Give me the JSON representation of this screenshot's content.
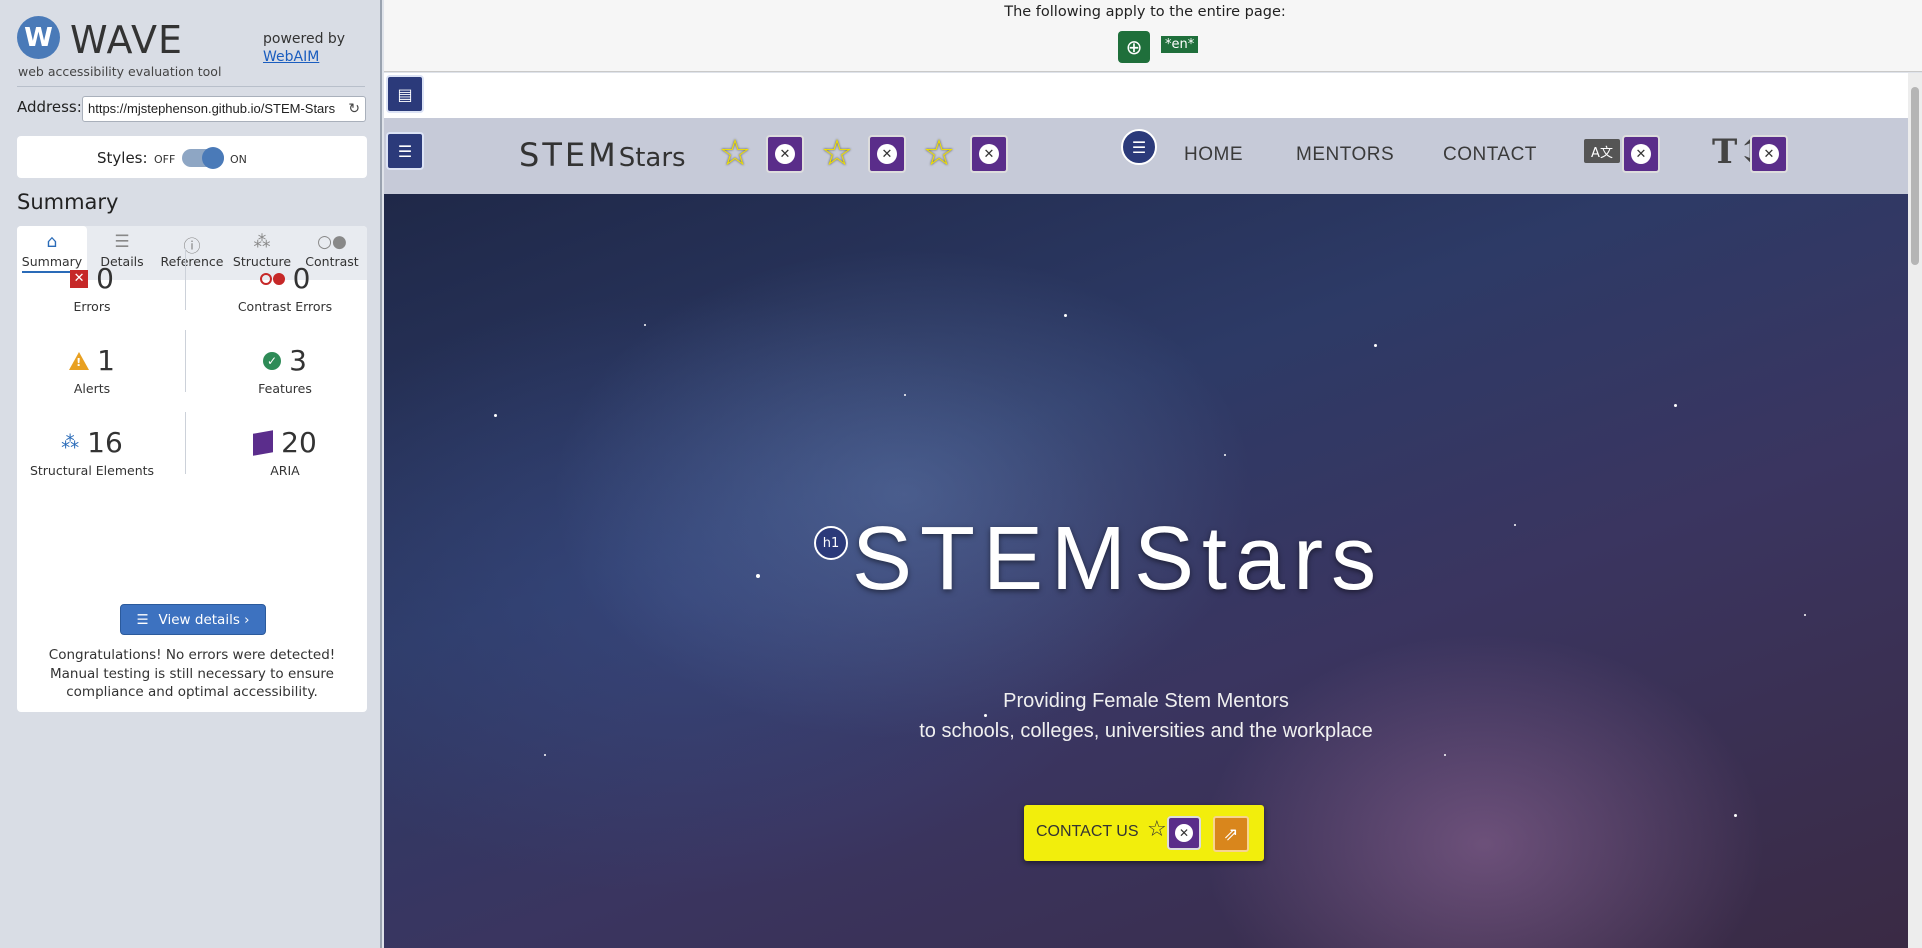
{
  "wave": {
    "logo_text": "WAVE",
    "logo_subtitle": "web accessibility evaluation tool",
    "powered_by": "powered by",
    "webaim_link": "WebAIM",
    "address_label": "Address:",
    "address_value": "https://mjstephenson.github.io/STEM-Stars",
    "styles_label": "Styles:",
    "styles_off": "OFF",
    "styles_on": "ON",
    "summary_heading": "Summary",
    "tabs": [
      {
        "label": "Summary",
        "icon": "home-icon",
        "active": true
      },
      {
        "label": "Details",
        "icon": "list-icon",
        "active": false
      },
      {
        "label": "Reference",
        "icon": "info-icon",
        "active": false
      },
      {
        "label": "Structure",
        "icon": "structure-icon",
        "active": false
      },
      {
        "label": "Contrast",
        "icon": "contrast-icon",
        "active": false
      }
    ],
    "stats": {
      "errors": {
        "value": "0",
        "label": "Errors"
      },
      "contrast_errors": {
        "value": "0",
        "label": "Contrast Errors"
      },
      "alerts": {
        "value": "1",
        "label": "Alerts"
      },
      "features": {
        "value": "3",
        "label": "Features"
      },
      "structural": {
        "value": "16",
        "label": "Structural Elements"
      },
      "aria": {
        "value": "20",
        "label": "ARIA"
      }
    },
    "view_details": "View details ›",
    "congrats": "Congratulations! No errors were detected! Manual testing is still necessary to ensure compliance and optimal accessibility."
  },
  "page_bar": {
    "applies_text": "The following apply to the entire page:",
    "lang_badge": "*en*"
  },
  "site": {
    "brand_main": "STEM",
    "brand_small": "Stars",
    "nav": [
      "HOME",
      "MENTORS",
      "CONTACT"
    ],
    "h1_badge": "h1",
    "hero_title": "STEMStars",
    "hero_line1": "Providing Female Stem Mentors",
    "hero_line2": "to schools, colleges, universities and the workplace",
    "cta_label": "CONTACT US"
  },
  "colors": {
    "wave_blue": "#3d72c0",
    "error_red": "#c62828",
    "alert_orange": "#e8a021",
    "feature_green": "#2e8b57",
    "aria_purple": "#5b2d8c",
    "cta_yellow": "#f2ee0c"
  }
}
